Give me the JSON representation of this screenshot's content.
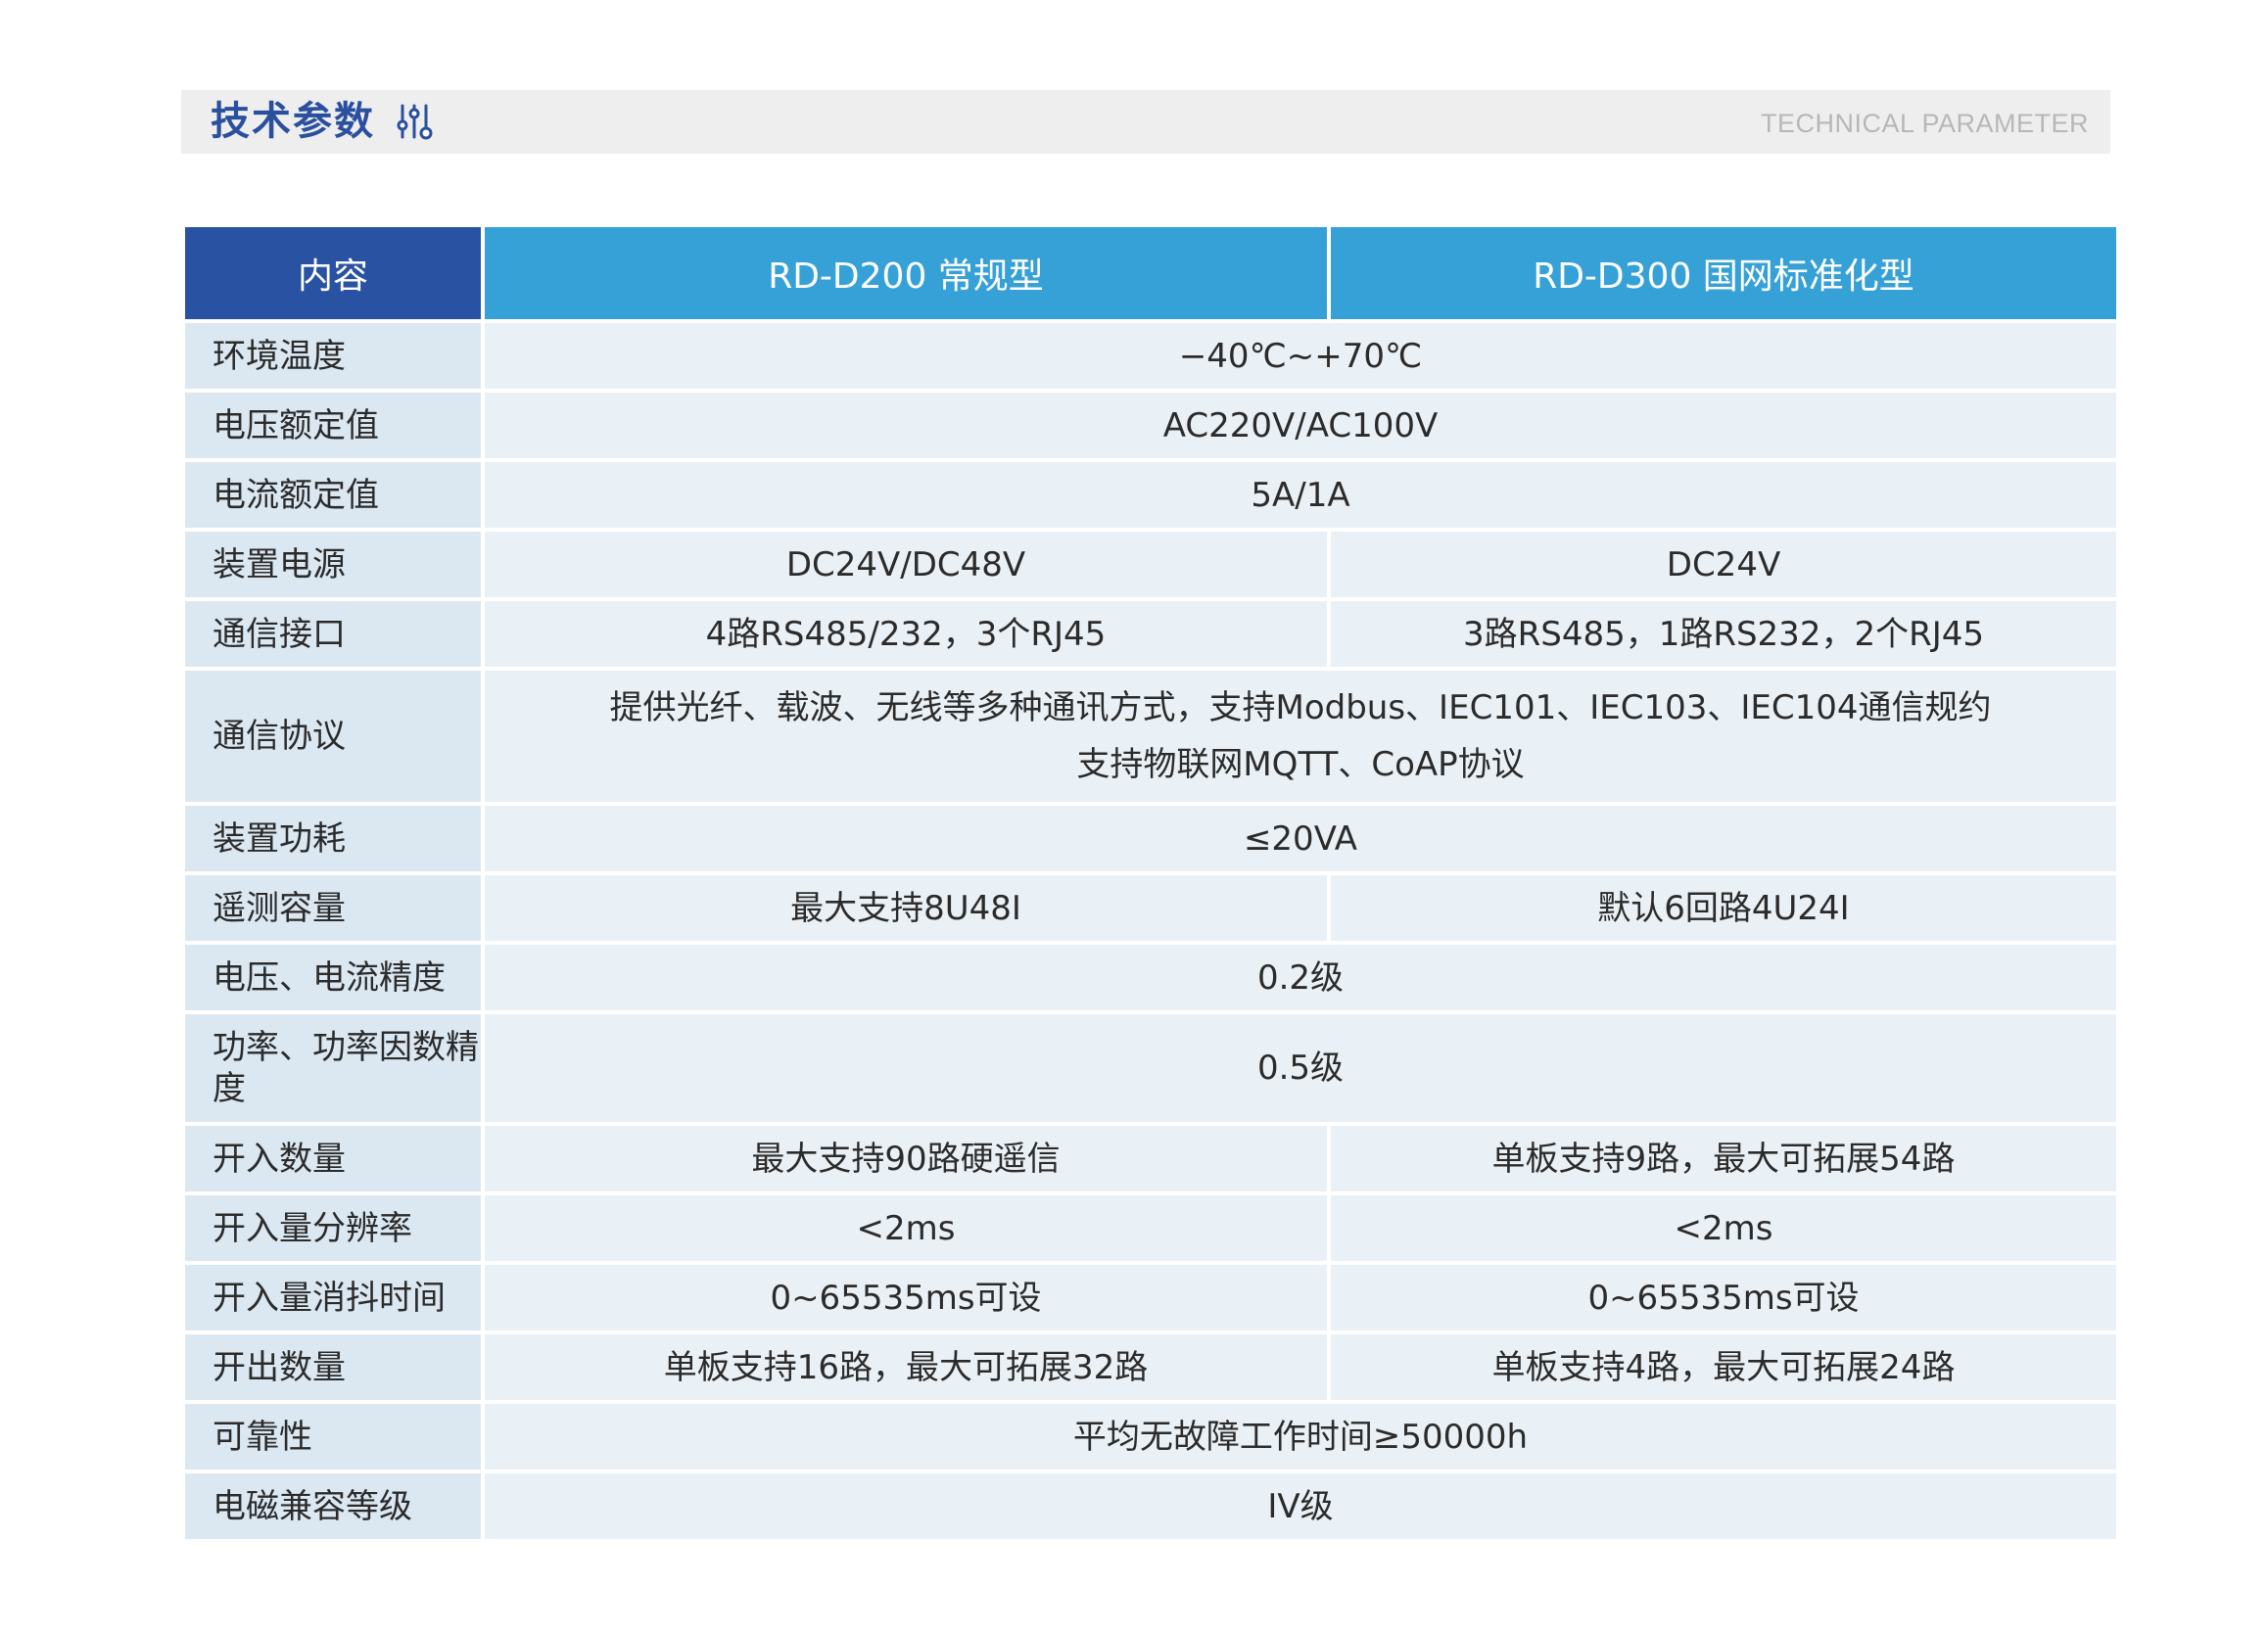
{
  "header": {
    "title": "技术参数",
    "subtitle_en": "TECHNICAL PARAMETER"
  },
  "table": {
    "columns": [
      "内容",
      "RD-D200 常规型",
      "RD-D300 国网标准化型"
    ],
    "rows": [
      {
        "label": "环境温度",
        "value": "−40℃~+70℃"
      },
      {
        "label": "电压额定值",
        "value": "AC220V/AC100V"
      },
      {
        "label": "电流额定值",
        "value": "5A/1A"
      },
      {
        "label": "装置电源",
        "d200": "DC24V/DC48V",
        "d300": "DC24V"
      },
      {
        "label": "通信接口",
        "d200": "4路RS485/232，3个RJ45",
        "d300": "3路RS485，1路RS232，2个RJ45"
      },
      {
        "label": "通信协议",
        "value_line1": "提供光纤、载波、无线等多种通讯方式，支持Modbus、IEC101、IEC103、IEC104通信规约",
        "value_line2": "支持物联网MQTT、CoAP协议"
      },
      {
        "label": "装置功耗",
        "value": "≤20VA"
      },
      {
        "label": "遥测容量",
        "d200": "最大支持8U48I",
        "d300": "默认6回路4U24I"
      },
      {
        "label": "电压、电流精度",
        "value": "0.2级"
      },
      {
        "label": "功率、功率因数精度",
        "value": "0.5级"
      },
      {
        "label": "开入数量",
        "d200": "最大支持90路硬遥信",
        "d300": "单板支持9路，最大可拓展54路"
      },
      {
        "label": "开入量分辨率",
        "d200": "<2ms",
        "d300": "<2ms"
      },
      {
        "label": "开入量消抖时间",
        "d200": "0~65535ms可设",
        "d300": "0~65535ms可设"
      },
      {
        "label": "开出数量",
        "d200": "单板支持16路，最大可拓展32路",
        "d300": "单板支持4路，最大可拓展24路"
      },
      {
        "label": "可靠性",
        "value": "平均无故障工作时间≥50000h"
      },
      {
        "label": "电磁兼容等级",
        "value": "IV级"
      }
    ]
  },
  "icons": {
    "header_icon": "sliders-icon"
  },
  "colors": {
    "title": "#2a4f9e",
    "header_dark": "#2a52a3",
    "header_light": "#36a1d6",
    "label_bg": "#dbe8f2",
    "cell_bg": "#eaf1f6"
  }
}
